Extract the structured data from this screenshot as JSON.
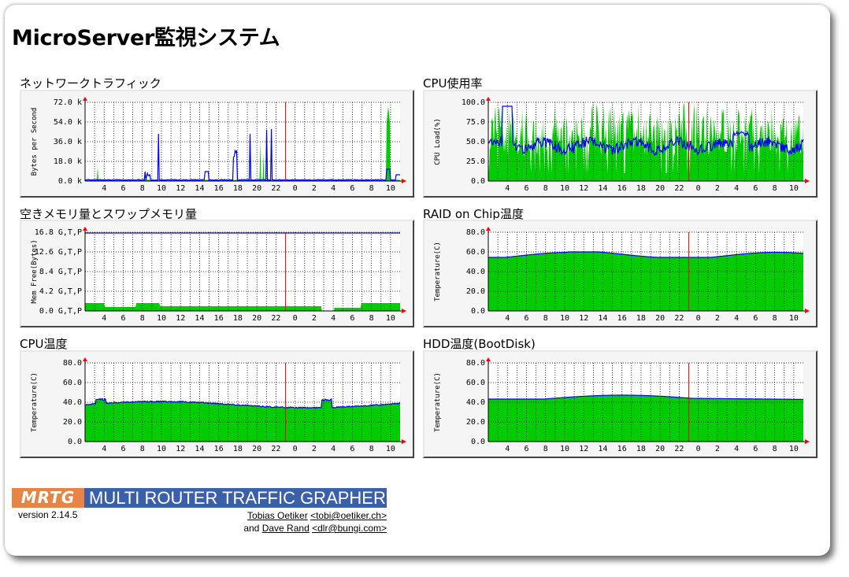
{
  "title": "MicroServer監視システム",
  "hour_labels": [
    "4",
    "6",
    "8",
    "10",
    "12",
    "14",
    "16",
    "18",
    "20",
    "22",
    "0",
    "2",
    "4",
    "6",
    "8",
    "10"
  ],
  "graphs": [
    {
      "id": "traffic",
      "title": "ネットワークトラフィック",
      "ylabel": "Bytes per Second",
      "yticks": [
        "72.0 k",
        "54.0 k",
        "36.0 k",
        "18.0 k",
        "0.0 k"
      ],
      "hour_labels": [
        "4",
        "6",
        "8",
        "10",
        "12",
        "14",
        "16",
        "18",
        "20",
        "22",
        "0",
        "2",
        "4",
        "6",
        "8",
        "10"
      ]
    },
    {
      "id": "cpu",
      "title": "CPU使用率",
      "ylabel": "CPU Load(%)",
      "yticks": [
        "100.0",
        "75.0",
        "50.0",
        "25.0",
        "0.0"
      ],
      "hour_labels": [
        "4",
        "6",
        "8",
        "10",
        "12",
        "14",
        "16",
        "18",
        "20",
        "22",
        "0",
        "2",
        "4",
        "6",
        "8",
        "10"
      ]
    },
    {
      "id": "mem",
      "title": "空きメモリ量とスワップメモリ量",
      "ylabel": "Mem Free(Bytes)",
      "yticks": [
        "16.8 G,T,P",
        "12.6 G,T,P",
        "8.4 G,T,P",
        "4.2 G,T,P",
        "0.0 G,T,P"
      ],
      "hour_labels": [
        "4",
        "6",
        "8",
        "10",
        "12",
        "14",
        "16",
        "18",
        "20",
        "22",
        "0",
        "2",
        "4",
        "6",
        "8",
        "10"
      ]
    },
    {
      "id": "raid",
      "title": "RAID on Chip温度",
      "ylabel": "Temperature(C)",
      "yticks": [
        "80.0",
        "60.0",
        "40.0",
        "20.0",
        "0.0"
      ],
      "hour_labels": [
        "4",
        "6",
        "8",
        "10",
        "12",
        "14",
        "16",
        "18",
        "20",
        "22",
        "0",
        "2",
        "4",
        "6",
        "8",
        "10"
      ]
    },
    {
      "id": "cputemp",
      "title": "CPU温度",
      "ylabel": "Temperature(C)",
      "yticks": [
        "80.0",
        "60.0",
        "40.0",
        "20.0",
        "0.0"
      ],
      "hour_labels": [
        "4",
        "6",
        "8",
        "10",
        "12",
        "14",
        "16",
        "18",
        "20",
        "22",
        "0",
        "2",
        "4",
        "6",
        "8",
        "10"
      ]
    },
    {
      "id": "hdd",
      "title": "HDD温度(BootDisk)",
      "ylabel": "Temperature(C)",
      "yticks": [
        "80.0",
        "60.0",
        "40.0",
        "20.0",
        "0.0"
      ],
      "hour_labels": [
        "4",
        "6",
        "8",
        "10",
        "12",
        "14",
        "16",
        "18",
        "20",
        "22",
        "0",
        "2",
        "4",
        "6",
        "8",
        "10"
      ]
    }
  ],
  "colors": {
    "in_fill": "#00cc00",
    "out_line": "#0000ff",
    "now_line": "#ff0000",
    "grid": "#000000"
  },
  "footer": {
    "logo_badge": "MRTG",
    "logo_text": "MULTI ROUTER TRAFFIC GRAPHER",
    "version": "version 2.14.5",
    "author1": "Tobias Oetiker",
    "author1_email": "<tobi@oetiker.ch>",
    "and": "and",
    "author2": "Dave Rand",
    "author2_email": "<dlr@bungi.com>"
  }
}
